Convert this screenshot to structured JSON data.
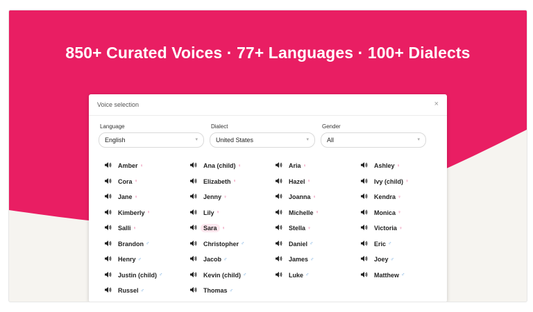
{
  "hero": {
    "headline": "850+ Curated Voices · 77+ Languages · 100+ Dialects",
    "accent_color": "#e91e63"
  },
  "dialog": {
    "title": "Voice selection",
    "close_symbol": "×",
    "filters": [
      {
        "label": "Language",
        "value": "English"
      },
      {
        "label": "Dialect",
        "value": "United States"
      },
      {
        "label": "Gender",
        "value": "All"
      }
    ]
  },
  "voices": [
    {
      "name": "Amber",
      "gender": "female"
    },
    {
      "name": "Ana (child)",
      "gender": "female"
    },
    {
      "name": "Aria",
      "gender": "female"
    },
    {
      "name": "Ashley",
      "gender": "female"
    },
    {
      "name": "Cora",
      "gender": "female"
    },
    {
      "name": "Elizabeth",
      "gender": "female"
    },
    {
      "name": "Hazel",
      "gender": "female"
    },
    {
      "name": "Ivy (child)",
      "gender": "female"
    },
    {
      "name": "Jane",
      "gender": "female"
    },
    {
      "name": "Jenny",
      "gender": "female"
    },
    {
      "name": "Joanna",
      "gender": "female"
    },
    {
      "name": "Kendra",
      "gender": "female"
    },
    {
      "name": "Kimberly",
      "gender": "female"
    },
    {
      "name": "Lily",
      "gender": "female"
    },
    {
      "name": "Michelle",
      "gender": "female"
    },
    {
      "name": "Monica",
      "gender": "female"
    },
    {
      "name": "Salli",
      "gender": "female"
    },
    {
      "name": "Sara",
      "gender": "female",
      "selected": true
    },
    {
      "name": "Stella",
      "gender": "female"
    },
    {
      "name": "Victoria",
      "gender": "female"
    },
    {
      "name": "Brandon",
      "gender": "male"
    },
    {
      "name": "Christopher",
      "gender": "male"
    },
    {
      "name": "Daniel",
      "gender": "male"
    },
    {
      "name": "Eric",
      "gender": "male"
    },
    {
      "name": "Henry",
      "gender": "male"
    },
    {
      "name": "Jacob",
      "gender": "male"
    },
    {
      "name": "James",
      "gender": "male"
    },
    {
      "name": "Joey",
      "gender": "male"
    },
    {
      "name": "Justin (child)",
      "gender": "male"
    },
    {
      "name": "Kevin (child)",
      "gender": "male"
    },
    {
      "name": "Luke",
      "gender": "male"
    },
    {
      "name": "Matthew",
      "gender": "male"
    },
    {
      "name": "Russel",
      "gender": "male"
    },
    {
      "name": "Thomas",
      "gender": "male"
    }
  ],
  "icons": {
    "speaker": "speaker-icon",
    "female": "female-symbol-icon",
    "male": "male-symbol-icon",
    "chevron": "chevron-down-icon"
  }
}
